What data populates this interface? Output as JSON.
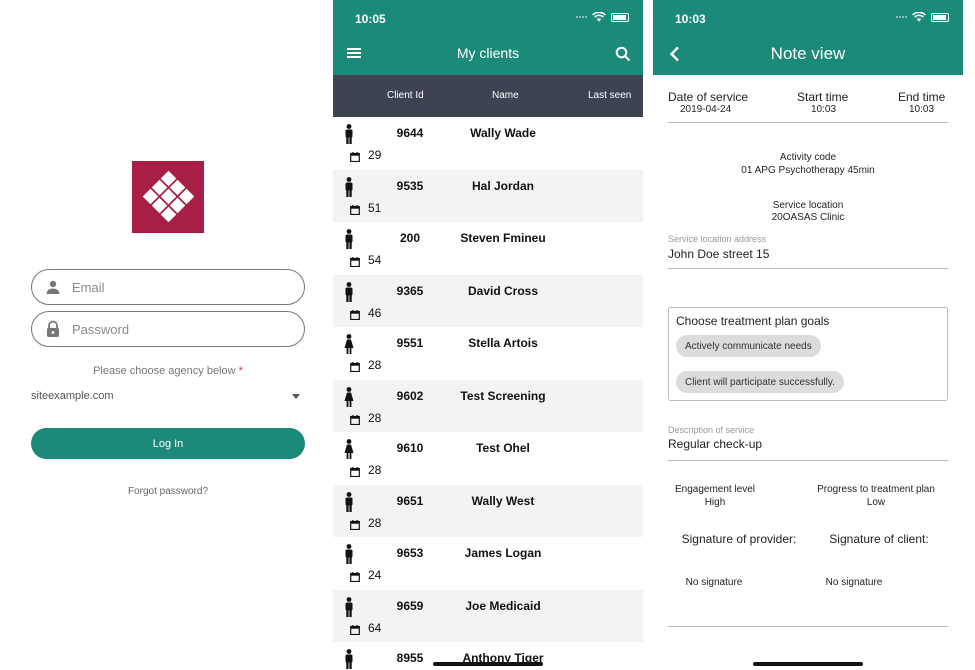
{
  "login": {
    "email_placeholder": "Email",
    "password_placeholder": "Password",
    "agency_label": "Please choose agency below",
    "agency_required_mark": "*",
    "agency_value": "siteexample.com",
    "login_button": "Log In",
    "forgot_password": "Forgot password?",
    "brand_color": "#a81f45"
  },
  "clients": {
    "status_time": "10:05",
    "title": "My clients",
    "columns": {
      "id": "Client Id",
      "name": "Name",
      "last_seen": "Last seen"
    },
    "accent_color": "#1b8a7a",
    "header_color": "#3d4351",
    "rows": [
      {
        "id": "9644",
        "name": "Wally Wade",
        "days": "29",
        "gender": "male"
      },
      {
        "id": "9535",
        "name": "Hal Jordan",
        "days": "51",
        "gender": "male"
      },
      {
        "id": "200",
        "name": "Steven Fmineu",
        "days": "54",
        "gender": "male"
      },
      {
        "id": "9365",
        "name": "David Cross",
        "days": "46",
        "gender": "male"
      },
      {
        "id": "9551",
        "name": "Stella Artois",
        "days": "28",
        "gender": "female"
      },
      {
        "id": "9602",
        "name": "Test Screening",
        "days": "28",
        "gender": "female"
      },
      {
        "id": "9610",
        "name": "Test Ohel",
        "days": "28",
        "gender": "female"
      },
      {
        "id": "9651",
        "name": "Wally West",
        "days": "28",
        "gender": "male"
      },
      {
        "id": "9653",
        "name": "James Logan",
        "days": "24",
        "gender": "male"
      },
      {
        "id": "9659",
        "name": "Joe Medicaid",
        "days": "64",
        "gender": "male"
      },
      {
        "id": "8955",
        "name": "Anthony Tiger",
        "days": "",
        "gender": "male"
      }
    ]
  },
  "note": {
    "status_time": "10:03",
    "title": "Note view",
    "date_of_service_label": "Date of service",
    "date_of_service": "2019-04-24",
    "start_time_label": "Start time",
    "start_time": "10:03",
    "end_time_label": "End time",
    "end_time": "10:03",
    "activity_code_label": "Activity code",
    "activity_code": "01 APG Psychotherapy 45min",
    "service_location_label": "Service location",
    "service_location": "20OASAS Clinic",
    "address_label": "Service location address",
    "address": "John Doe street 15",
    "goals_title": "Choose treatment plan goals",
    "goals": [
      "Actively communicate needs",
      "Client will participate successfully."
    ],
    "description_label": "Description of service",
    "description": "Regular check-up",
    "engagement_label": "Engagement level",
    "engagement": "High",
    "progress_label": "Progress to treatment plan",
    "progress": "Low",
    "sig_provider_label": "Signature of provider:",
    "sig_client_label": "Signature of client:",
    "sig_provider": "No signature",
    "sig_client": "No signature"
  }
}
